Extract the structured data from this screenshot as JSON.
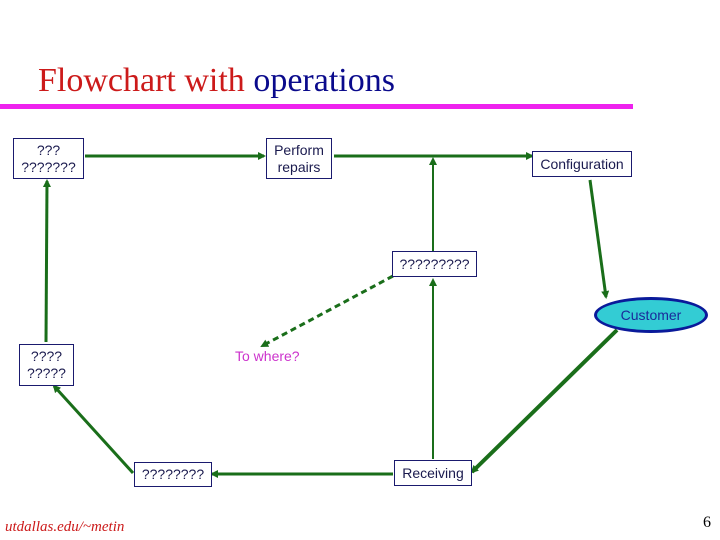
{
  "title": {
    "part1": "Flowchart with ",
    "part2": "operations"
  },
  "colors": {
    "title_red": "#cc1a1a",
    "title_blue": "#0a0a8c",
    "rule": "#ee22ee",
    "edge": "#1a6e1a",
    "customer_fill": "#33ccd4",
    "customer_border": "#0a1a9a",
    "annotation": "#cc33cc"
  },
  "nodes": {
    "top_left": {
      "line1": "???",
      "line2": "???????"
    },
    "perform_repairs": {
      "line1": "Perform",
      "line2": "repairs"
    },
    "configuration": {
      "label": "Configuration"
    },
    "middle": {
      "label": "?????????"
    },
    "customer": {
      "label": "Customer"
    },
    "mid_left": {
      "line1": "????",
      "line2": "?????"
    },
    "bottom_left": {
      "label": "????????"
    },
    "receiving": {
      "label": "Receiving"
    }
  },
  "annotation": "To where?",
  "footer": {
    "url": "utdallas.edu/~metin",
    "page": "6"
  }
}
